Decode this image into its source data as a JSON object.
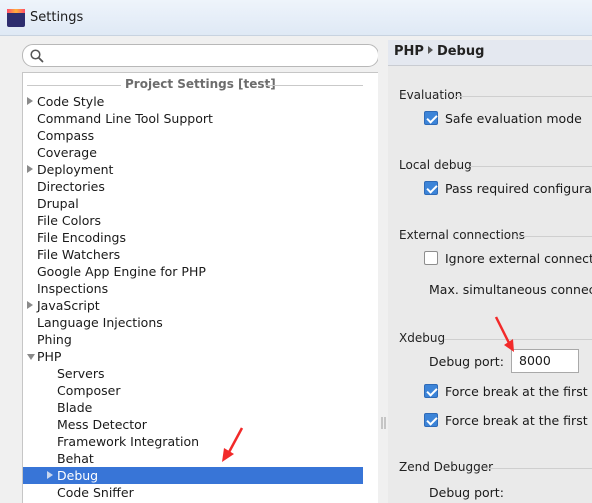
{
  "window": {
    "title": "Settings",
    "icon_label": "PHP"
  },
  "search": {
    "placeholder": ""
  },
  "tree": {
    "group_title": "Project Settings [test]",
    "items": [
      {
        "label": "Code Style",
        "expandable": true
      },
      {
        "label": "Command Line Tool Support",
        "expandable": false
      },
      {
        "label": "Compass",
        "expandable": false
      },
      {
        "label": "Coverage",
        "expandable": false
      },
      {
        "label": "Deployment",
        "expandable": true
      },
      {
        "label": "Directories",
        "expandable": false
      },
      {
        "label": "Drupal",
        "expandable": false
      },
      {
        "label": "File Colors",
        "expandable": false
      },
      {
        "label": "File Encodings",
        "expandable": false
      },
      {
        "label": "File Watchers",
        "expandable": false
      },
      {
        "label": "Google App Engine for PHP",
        "expandable": false
      },
      {
        "label": "Inspections",
        "expandable": false
      },
      {
        "label": "JavaScript",
        "expandable": true
      },
      {
        "label": "Language Injections",
        "expandable": false
      },
      {
        "label": "Phing",
        "expandable": false
      },
      {
        "label": "PHP",
        "expandable": true,
        "expanded": true
      }
    ],
    "php_children": [
      {
        "label": "Servers"
      },
      {
        "label": "Composer"
      },
      {
        "label": "Blade"
      },
      {
        "label": "Mess Detector"
      },
      {
        "label": "Framework Integration"
      },
      {
        "label": "Behat"
      },
      {
        "label": "Debug",
        "selected": true,
        "expandable": true
      },
      {
        "label": "Code Sniffer"
      }
    ]
  },
  "panel": {
    "breadcrumb_parent": "PHP",
    "breadcrumb_current": "Debug",
    "evaluation": {
      "title": "Evaluation",
      "safe_mode_label": "Safe evaluation mode",
      "safe_mode_checked": true
    },
    "local_debug": {
      "title": "Local debug",
      "pass_required_label": "Pass required configuratio",
      "pass_required_checked": true
    },
    "external": {
      "title": "External connections",
      "ignore_label": "Ignore external connectio",
      "ignore_checked": false,
      "max_label": "Max. simultaneous connectio"
    },
    "xdebug": {
      "title": "Xdebug",
      "port_label": "Debug port:",
      "port_value": "8000",
      "force_break_1_label": "Force break at the first lin",
      "force_break_1_checked": true,
      "force_break_2_label": "Force break at the first lin",
      "force_break_2_checked": true
    },
    "zend": {
      "title": "Zend Debugger",
      "port_label": "Debug port:"
    }
  },
  "colors": {
    "selection": "#3875d7",
    "annotation_arrow": "#f22a2a",
    "checkbox_checked": "#3c84d8"
  }
}
